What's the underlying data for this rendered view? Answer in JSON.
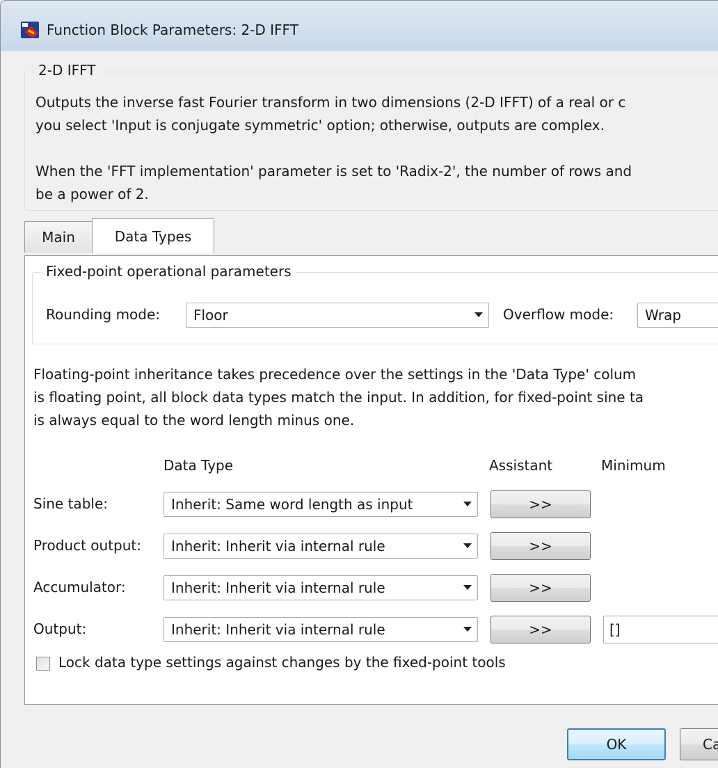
{
  "window": {
    "title": "Function Block Parameters: 2-D IFFT"
  },
  "block": {
    "group_title": "2-D IFFT",
    "description_lines": [
      "Outputs the inverse fast Fourier transform in two dimensions (2-D IFFT) of a real or c",
      "you select 'Input is conjugate symmetric' option; otherwise, outputs are complex.",
      "",
      "When the 'FFT implementation' parameter is set to 'Radix-2', the number of rows and",
      "be a power of 2."
    ]
  },
  "tabs": [
    {
      "label": "Main",
      "active": false
    },
    {
      "label": "Data Types",
      "active": true
    }
  ],
  "fixed_point": {
    "group_title": "Fixed-point operational parameters",
    "rounding_label": "Rounding mode:",
    "rounding_value": "Floor",
    "overflow_label": "Overflow mode:",
    "overflow_value": "Wrap"
  },
  "inheritance_note_lines": [
    "Floating-point inheritance takes precedence over the settings in the 'Data Type' colum",
    "is floating point, all block data types match the input. In addition, for fixed-point sine ta",
    "is always equal to the word length minus one."
  ],
  "table": {
    "headers": {
      "data_type": "Data Type",
      "assistant": "Assistant",
      "minimum": "Minimum"
    },
    "rows": [
      {
        "label": "Sine table:",
        "value": "Inherit: Same word length as input",
        "assistant": ">>",
        "minimum": ""
      },
      {
        "label": "Product output:",
        "value": "Inherit: Inherit via internal rule",
        "assistant": ">>",
        "minimum": ""
      },
      {
        "label": "Accumulator:",
        "value": "Inherit: Inherit via internal rule",
        "assistant": ">>",
        "minimum": ""
      },
      {
        "label": "Output:",
        "value": "Inherit: Inherit via internal rule",
        "assistant": ">>",
        "minimum": "[]"
      }
    ]
  },
  "lock_checkbox": {
    "label": "Lock data type settings against changes by the fixed-point tools",
    "checked": false
  },
  "buttons": {
    "ok": "OK",
    "cancel": "Ca"
  }
}
